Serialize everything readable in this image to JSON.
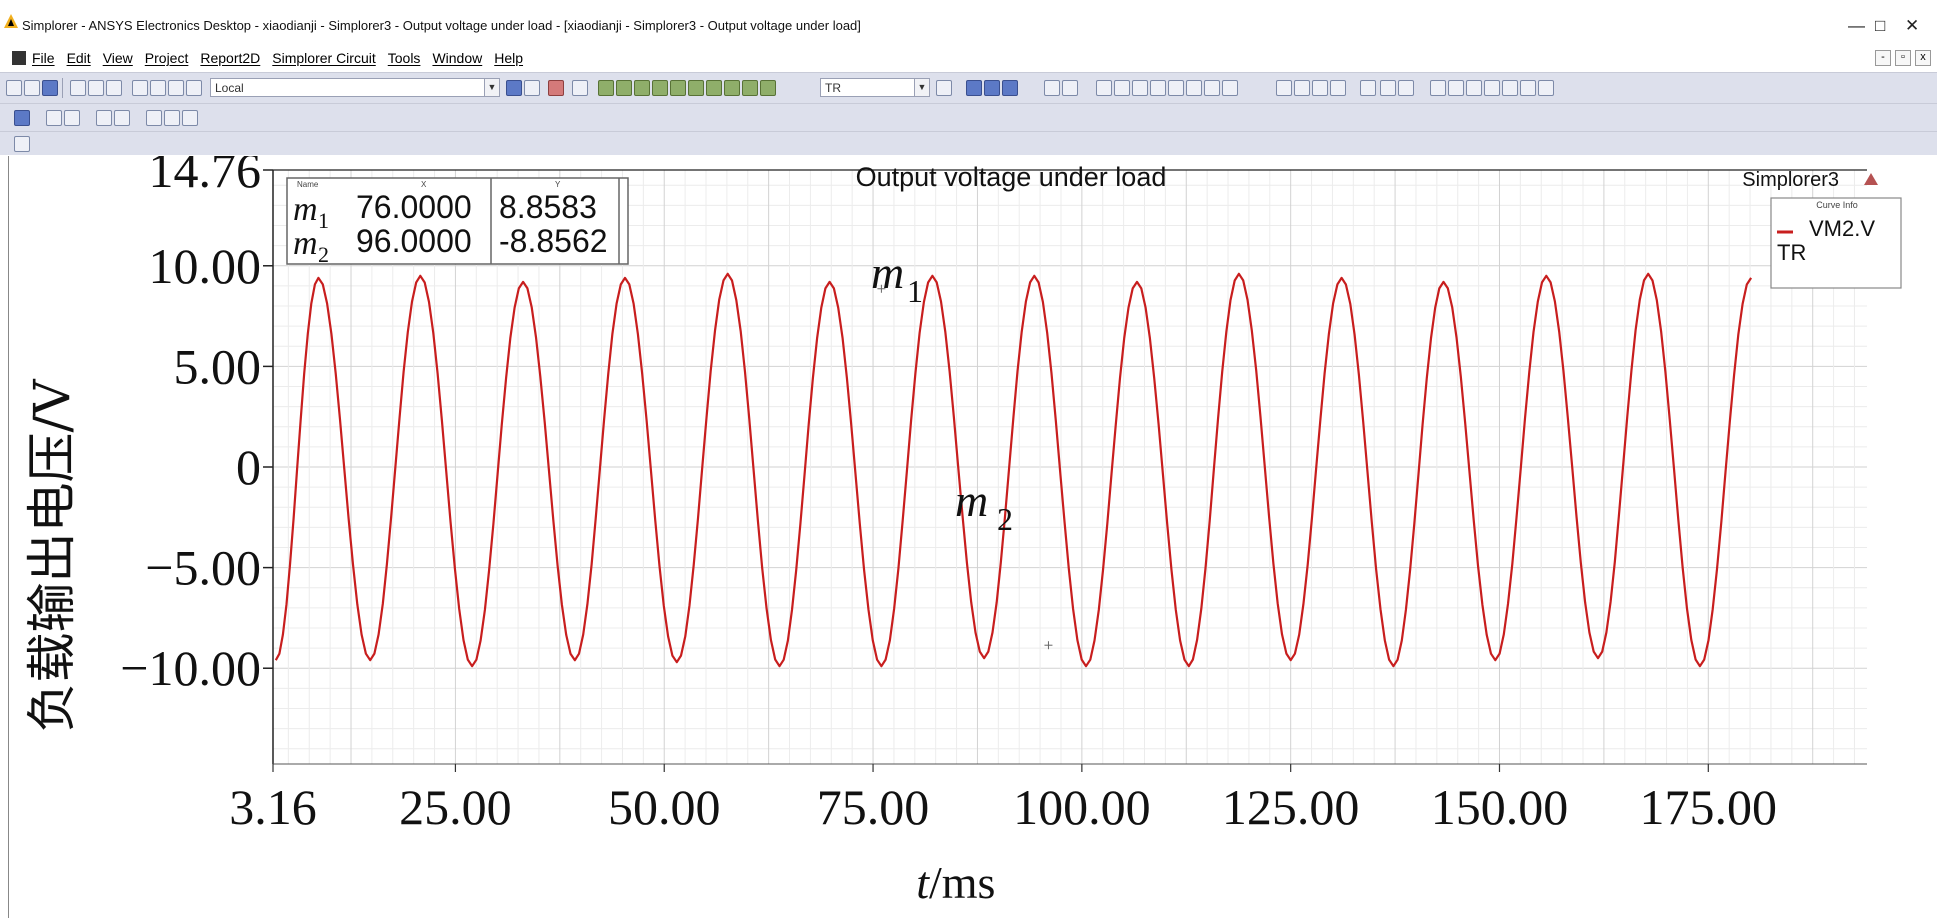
{
  "window": {
    "title": "Simplorer - ANSYS Electronics Desktop - xiaodianji - Simplorer3 - Output voltage under load - [xiaodianji - Simplorer3 - Output voltage under load]",
    "controls": {
      "minimize": "—",
      "restore": "□",
      "close": "✕"
    }
  },
  "menu": {
    "items": [
      "File",
      "Edit",
      "View",
      "Project",
      "Report2D",
      "Simplorer Circuit",
      "Tools",
      "Window",
      "Help"
    ],
    "mdi_controls": [
      "-",
      "▫",
      "x"
    ]
  },
  "toolbar": {
    "combo_left": "Local",
    "combo_right": "TR"
  },
  "plot": {
    "title": "Output voltage under load",
    "design_name": "Simplorer3",
    "legend": {
      "header": "Curve Info",
      "series": "VM2.V",
      "sub": "TR",
      "color": "#c81e1e"
    },
    "marker_table": {
      "headers": [
        "Name",
        "X",
        "Y"
      ],
      "rows": [
        {
          "name": "m",
          "sub": "1",
          "x": "76.0000",
          "y": "8.8583"
        },
        {
          "name": "m",
          "sub": "2",
          "x": "96.0000",
          "y": "-8.8562"
        }
      ]
    },
    "marker_labels": [
      {
        "name": "m",
        "sub": "1"
      },
      {
        "name": "m",
        "sub": "2"
      }
    ]
  },
  "chart_data": {
    "type": "line",
    "title": "Output voltage under load",
    "xlabel_italic": "t",
    "xlabel_unit": "/ms",
    "ylabel": "负载输出电压/V",
    "xlim": [
      3.16,
      194
    ],
    "ylim": [
      -14.76,
      14.76
    ],
    "xticks": [
      3.16,
      25,
      50,
      75,
      100,
      125,
      150,
      175
    ],
    "xtick_labels": [
      "3.16",
      "25.00",
      "50.00",
      "75.00",
      "100.00",
      "125.00",
      "150.00",
      "175.00"
    ],
    "yticks": [
      14.76,
      10,
      5,
      0,
      -5,
      -10
    ],
    "ytick_labels": [
      "14.76",
      "10.00",
      "5.00",
      "0",
      "−5.00",
      "−10.00"
    ],
    "grid": true,
    "series": [
      {
        "name": "VM2.V",
        "color": "#c81e1e",
        "period_ms": 12.25,
        "first_peak_ms": 8.6,
        "amplitude": 9.4,
        "peaks": [
          {
            "x": 8.6,
            "y": 9.4
          },
          {
            "x": 20.8,
            "y": 9.5
          },
          {
            "x": 33.1,
            "y": 9.2
          },
          {
            "x": 45.3,
            "y": 9.4
          },
          {
            "x": 57.6,
            "y": 9.6
          },
          {
            "x": 69.8,
            "y": 9.2
          },
          {
            "x": 82.1,
            "y": 9.5
          },
          {
            "x": 94.3,
            "y": 9.5
          },
          {
            "x": 106.6,
            "y": 9.2
          },
          {
            "x": 118.8,
            "y": 9.6
          },
          {
            "x": 131.1,
            "y": 9.4
          },
          {
            "x": 143.3,
            "y": 9.2
          },
          {
            "x": 155.6,
            "y": 9.5
          },
          {
            "x": 167.8,
            "y": 9.6
          }
        ],
        "troughs": [
          {
            "x": 3.5,
            "y": -9.6
          },
          {
            "x": 14.8,
            "y": -9.6
          },
          {
            "x": 27.0,
            "y": -9.9
          },
          {
            "x": 39.3,
            "y": -9.6
          },
          {
            "x": 51.5,
            "y": -9.7
          },
          {
            "x": 63.8,
            "y": -9.9
          },
          {
            "x": 76.0,
            "y": -9.9
          },
          {
            "x": 88.3,
            "y": -9.5
          },
          {
            "x": 100.5,
            "y": -9.9
          },
          {
            "x": 112.8,
            "y": -9.9
          },
          {
            "x": 125.0,
            "y": -9.6
          },
          {
            "x": 137.3,
            "y": -9.9
          },
          {
            "x": 149.5,
            "y": -9.6
          },
          {
            "x": 161.8,
            "y": -9.5
          },
          {
            "x": 174.0,
            "y": -9.9
          }
        ]
      }
    ],
    "markers": [
      {
        "name": "m1",
        "x": 76.0,
        "y": 8.8583
      },
      {
        "name": "m2",
        "x": 96.0,
        "y": -8.8562
      }
    ]
  }
}
